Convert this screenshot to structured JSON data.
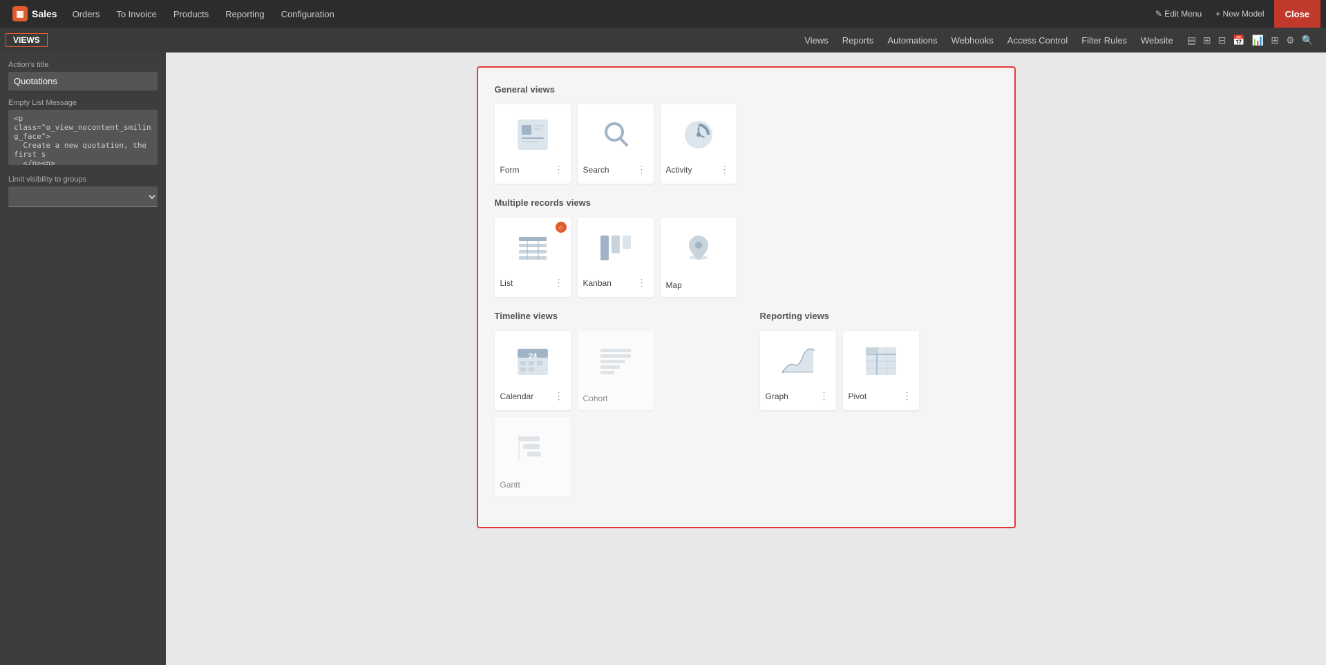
{
  "topbar": {
    "logo_text": "Sales",
    "nav_items": [
      "Orders",
      "To Invoice",
      "Products",
      "Reporting",
      "Configuration"
    ],
    "edit_menu_label": "✎ Edit Menu",
    "new_model_label": "+ New Model",
    "close_label": "Close"
  },
  "subnav": {
    "views_label": "VIEWS",
    "right_items": [
      "Views",
      "Reports",
      "Automations",
      "Webhooks",
      "Access Control",
      "Filter Rules",
      "Website"
    ]
  },
  "sidebar": {
    "action_title_label": "Action's title",
    "action_title_value": "Quotations",
    "empty_list_label": "Empty List Message",
    "empty_list_value": "<p class=\"o_view_nocontent_smiling_face\">\n  Create a new quotation, the first s\n  </p><p>\n  Once the quotation is confirmed by\n  </p>",
    "limit_label": "Limit visibility to groups",
    "limit_placeholder": ""
  },
  "views_panel": {
    "general_views_title": "General views",
    "multiple_records_title": "Multiple records views",
    "timeline_views_title": "Timeline views",
    "reporting_views_title": "Reporting views",
    "general_views": [
      {
        "id": "form",
        "label": "Form",
        "has_menu": true,
        "disabled": false
      },
      {
        "id": "search",
        "label": "Search",
        "has_menu": true,
        "disabled": false
      },
      {
        "id": "activity",
        "label": "Activity",
        "has_menu": true,
        "disabled": false
      }
    ],
    "multiple_views": [
      {
        "id": "list",
        "label": "List",
        "has_menu": true,
        "disabled": false,
        "home": true
      },
      {
        "id": "kanban",
        "label": "Kanban",
        "has_menu": true,
        "disabled": false
      },
      {
        "id": "map",
        "label": "Map",
        "has_menu": false,
        "disabled": false
      }
    ],
    "timeline_views": [
      {
        "id": "calendar",
        "label": "Calendar",
        "has_menu": true,
        "disabled": false
      },
      {
        "id": "cohort",
        "label": "Cohort",
        "has_menu": false,
        "disabled": true
      },
      {
        "id": "gantt",
        "label": "Gantt",
        "has_menu": false,
        "disabled": true
      }
    ],
    "reporting_views": [
      {
        "id": "graph",
        "label": "Graph",
        "has_menu": true,
        "disabled": false
      },
      {
        "id": "pivot",
        "label": "Pivot",
        "has_menu": true,
        "disabled": false
      }
    ]
  }
}
